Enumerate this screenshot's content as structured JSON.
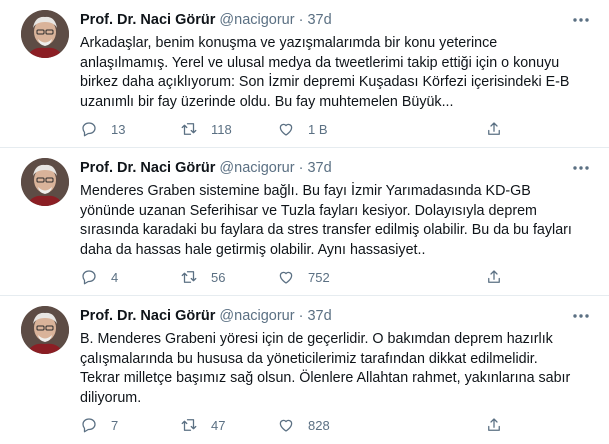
{
  "tweets": [
    {
      "name": "Prof. Dr. Naci Görür",
      "handle": "@nacigorur",
      "separator": "·",
      "time": "37d",
      "lines": [
        "Arkadaşlar, benim konuşma ve yazışmalarımda bir konu yeterince",
        "anlaşılmamış. Yerel ve ulusal medya da tweetlerimi takip ettiği için o konuyu",
        "birkez daha açıklıyorum: Son İzmir depremi Kuşadası Körfezi içerisindeki E-B",
        "uzanımlı bir fay üzerinde oldu. Bu fay muhtemelen Büyük..."
      ],
      "replies": "13",
      "retweets": "118",
      "likes": "1 B"
    },
    {
      "name": "Prof. Dr. Naci Görür",
      "handle": "@nacigorur",
      "separator": "·",
      "time": "37d",
      "lines": [
        "Menderes Graben sistemine bağlı. Bu fayı İzmir Yarımadasında KD-GB",
        "yönünde uzanan Seferihisar ve Tuzla fayları kesiyor. Dolayısıyla deprem",
        "sırasında karadaki bu faylara da stres transfer edilmiş olabilir. Bu da bu fayları",
        "daha da hassas hale getirmiş olabilir. Aynı hassasiyet.."
      ],
      "replies": "4",
      "retweets": "56",
      "likes": "752"
    },
    {
      "name": "Prof. Dr. Naci Görür",
      "handle": "@nacigorur",
      "separator": "·",
      "time": "37d",
      "lines": [
        "B. Menderes Grabeni yöresi için de geçerlidir. O bakımdan deprem hazırlık",
        "çalışmalarında bu hususa da yöneticilerimiz tarafından dikkat edilmelidir.",
        "Tekrar milletçe başımız sağ olsun. Ölenlere Allahtan rahmet, yakınlarına sabır",
        "diliyorum."
      ],
      "replies": "7",
      "retweets": "47",
      "likes": "828"
    }
  ],
  "colors": {
    "text": "#0f1419",
    "secondary": "#5b7083",
    "divider": "#e6ecf0"
  },
  "icons": [
    "more-icon",
    "reply-icon",
    "retweet-icon",
    "like-icon",
    "share-icon"
  ]
}
